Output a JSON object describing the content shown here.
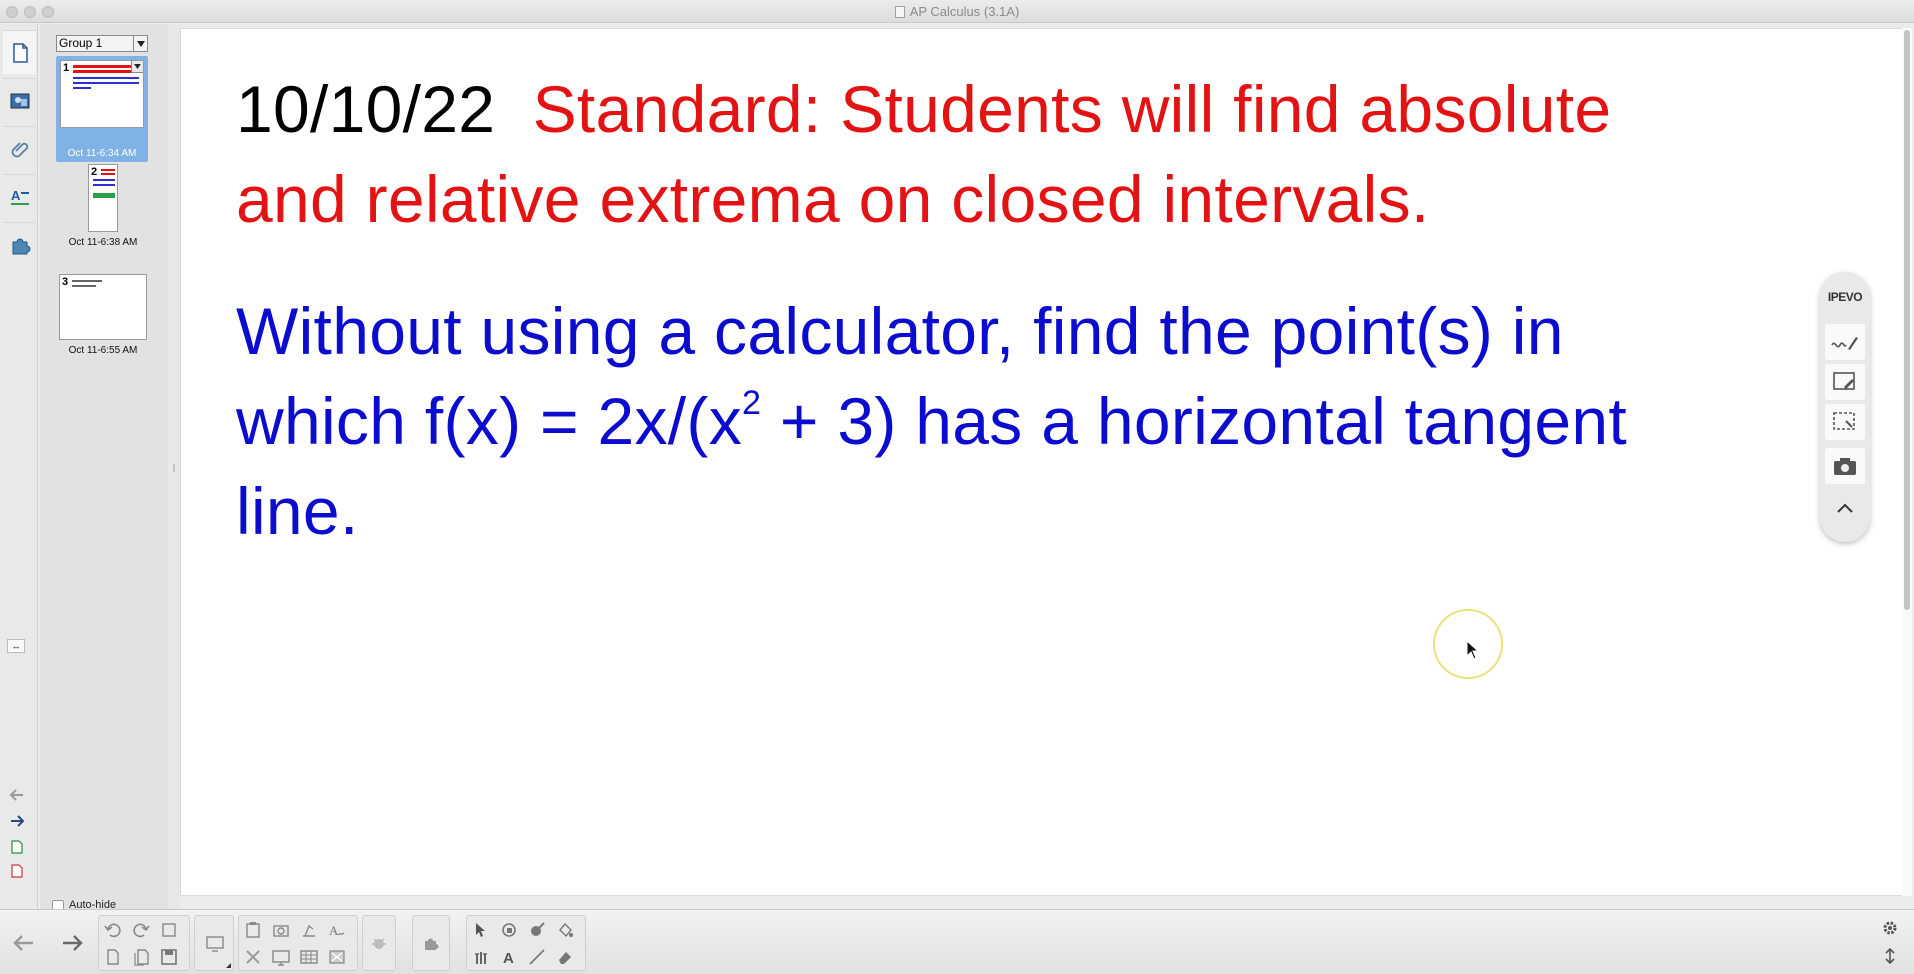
{
  "window": {
    "title": "AP Calculus (3.1A)"
  },
  "sidebar": {
    "group_label": "Group 1",
    "pages": [
      {
        "number": "1",
        "label": "Oct 11-6:34 AM",
        "selected": true
      },
      {
        "number": "2",
        "label": "Oct 11-6:38 AM",
        "selected": false
      },
      {
        "number": "3",
        "label": "Oct 11-6:55 AM",
        "selected": false
      }
    ],
    "autohide_label": "Auto-hide",
    "icon_tabs": [
      "page-sorter-icon",
      "gallery-icon",
      "attachments-icon",
      "properties-icon",
      "addons-icon"
    ]
  },
  "slide": {
    "date": "10/10/22",
    "standard_line1": "Standard: Students will find absolute",
    "standard_line2": "and relative extrema on closed intervals.",
    "question_line1": "Without using a calculator, find the point(s) in",
    "question_line2_a": "which f(x) = 2x/(x",
    "question_line2_sup": "2",
    "question_line2_b": " + 3) has a horizontal tangent",
    "question_line3": "line."
  },
  "ipevo": {
    "logo": "IPEVO"
  },
  "colors": {
    "standard": "#e31313",
    "question": "#0c0ccf",
    "date": "#000000",
    "selected_thumb": "#7fb2e5"
  }
}
